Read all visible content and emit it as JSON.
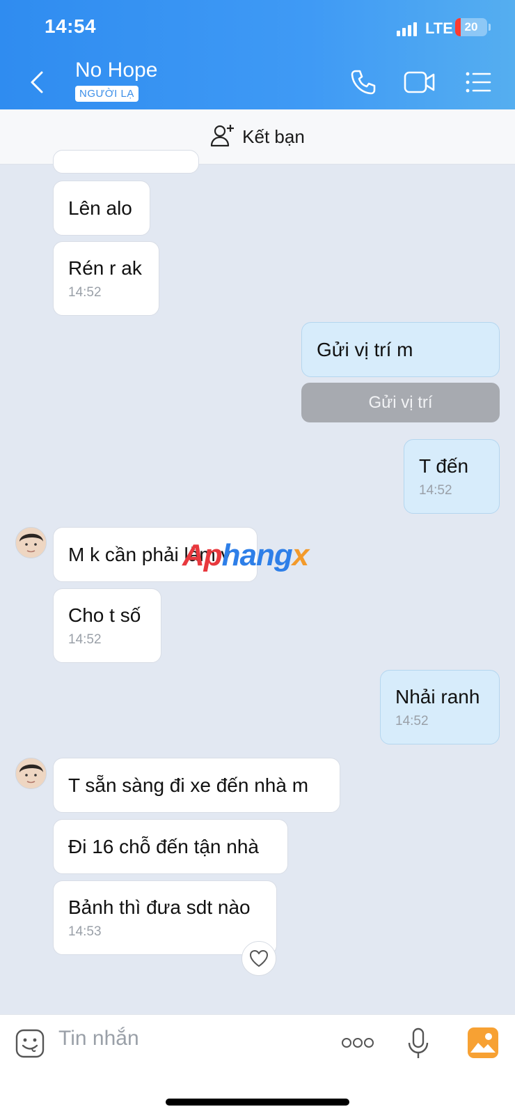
{
  "status_bar": {
    "time": "14:54",
    "network": "LTE",
    "battery": "20"
  },
  "header": {
    "contact_name": "No Hope",
    "badge": "NGƯỜI LẠ"
  },
  "friend_bar": {
    "label": "Kết bạn"
  },
  "messages": {
    "m1": {
      "text": "Lên alo"
    },
    "m2": {
      "text": "Rén r ak",
      "time": "14:52"
    },
    "m3": {
      "text": "Gửi vị trí m"
    },
    "m3_button": "Gửi vị trí",
    "m4": {
      "text": "T đến",
      "time": "14:52"
    },
    "m5": {
      "text": "M k cần phải làm v"
    },
    "m6": {
      "text": "Cho t số",
      "time": "14:52"
    },
    "m7": {
      "text": "Nhải ranh",
      "time": "14:52"
    },
    "m8": {
      "text": "T sẵn sàng đi xe đến nhà m"
    },
    "m9": {
      "text": "Đi 16 chỗ đến tận nhà"
    },
    "m10": {
      "text": "Bảnh thì đưa sdt nào",
      "time": "14:53"
    }
  },
  "watermark": {
    "part1": "Ap",
    "part2": "hang",
    "part3": "x"
  },
  "input": {
    "placeholder": "Tin nhắn"
  },
  "colors": {
    "header": "#2f8cf0",
    "incoming": "#ffffff",
    "outgoing": "#d7ecfb",
    "background": "#e2e8f2"
  },
  "icons": [
    "back-icon",
    "phone-icon",
    "video-call-icon",
    "menu-icon",
    "add-friend-icon",
    "heart-icon",
    "emoji-icon",
    "more-icon",
    "microphone-icon",
    "image-icon"
  ]
}
